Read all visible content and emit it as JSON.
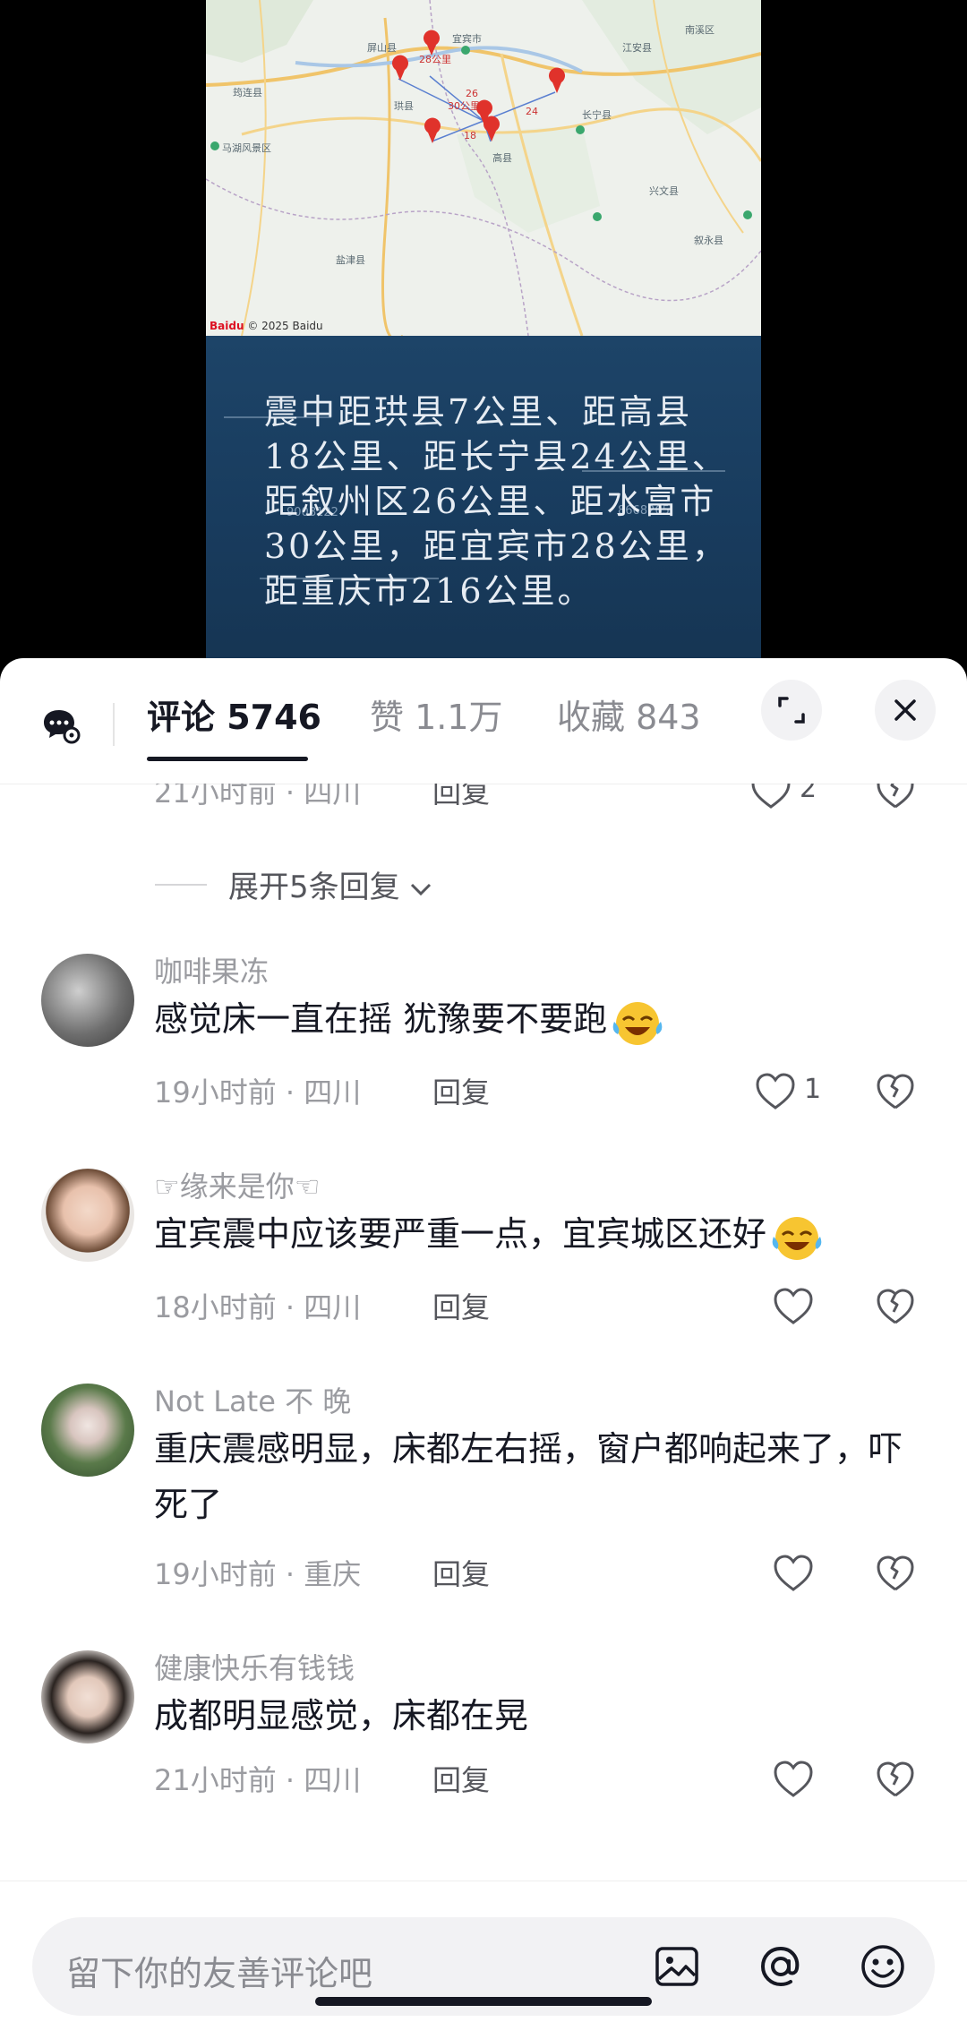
{
  "video": {
    "caption": "震中距珙县7公里、距高县18公里、距长宁县24公里、距叙州区26公里、距水富市30公里，距宜宾市28公里，距重庆市216公里。",
    "map_labels": [
      "宜宾市",
      "屏山县",
      "筠连县",
      "珙县",
      "高县",
      "兴文县",
      "长宁县",
      "江安县",
      "叙永县",
      "南溪区",
      "盐津县",
      "马湖风景区",
      "28公里",
      "26",
      "30公里",
      "24",
      "18",
      "© 2025 Baidu"
    ],
    "map_badge_text": "Baidu",
    "hud_numbers": [
      "9008122",
      "8668265"
    ]
  },
  "sheet": {
    "tabs": [
      {
        "label": "评论 5746"
      },
      {
        "label": "赞 1.1万"
      },
      {
        "label": "收藏 843"
      }
    ],
    "expand_icon": "expand-icon",
    "close_icon": "close-icon"
  },
  "thread": {
    "partial_meta": "21小时前 · 四川",
    "partial_reply": "回复",
    "partial_likes": "2",
    "expand_replies": "展开5条回复"
  },
  "comments": [
    {
      "user": "咖啡果冻",
      "text": "感觉床一直在摇 犹豫要不要跑",
      "meta": "19小时前 · 四川",
      "reply": "回复",
      "likes": "1",
      "emoji": "laugh-cry"
    },
    {
      "user": "☞缘来是你☜",
      "text": "宜宾震中应该要严重一点，宜宾城区还好",
      "meta": "18小时前 · 四川",
      "reply": "回复",
      "likes": "",
      "emoji": "laugh-cry"
    },
    {
      "user": "Not  Late 不 晚",
      "text": "重庆震感明显，床都左右摇，窗户都响起来了，吓死了",
      "meta": "19小时前 · 重庆",
      "reply": "回复",
      "likes": ""
    },
    {
      "user": "健康快乐有钱钱",
      "text": "成都明显感觉，床都在晃",
      "meta": "21小时前 · 四川",
      "reply": "回复",
      "likes": ""
    }
  ],
  "input": {
    "placeholder": "留下你的友善评论吧"
  },
  "colors": {
    "text_primary": "#161823",
    "text_secondary": "#9a9ba0",
    "panel_blue": "#1d4468",
    "pin_red": "#e0322b"
  }
}
